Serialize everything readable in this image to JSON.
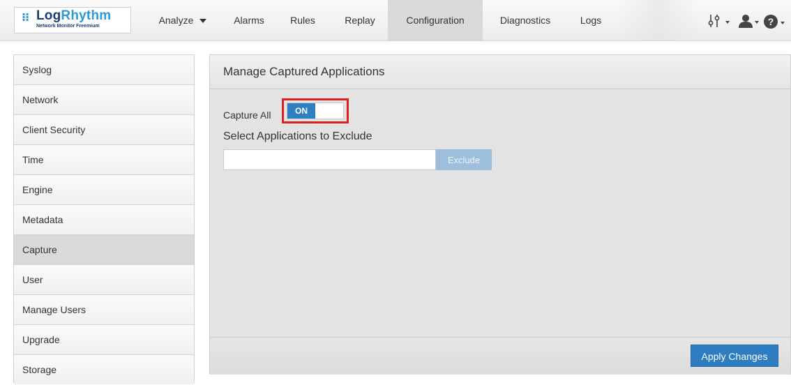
{
  "logo": {
    "name_part1": "Log",
    "name_part2": "Rhythm",
    "subtitle": "Network Monitor Freemium",
    "mark_icon": "dots-grid-icon",
    "colors": {
      "dark": "#1c3d73",
      "accent": "#2b9ad6"
    }
  },
  "nav": {
    "items": [
      {
        "label": "Analyze",
        "has_dropdown": true
      },
      {
        "label": "Alarms"
      },
      {
        "label": "Rules"
      },
      {
        "label": "Replay"
      },
      {
        "label": "Configuration",
        "active": true
      },
      {
        "label": "Diagnostics"
      },
      {
        "label": "Logs"
      }
    ],
    "tools": [
      "sliders-icon",
      "user-icon",
      "help-icon"
    ]
  },
  "sidebar": {
    "active": "Capture",
    "items": [
      {
        "label": "Syslog"
      },
      {
        "label": "Network"
      },
      {
        "label": "Client Security"
      },
      {
        "label": "Time"
      },
      {
        "label": "Engine"
      },
      {
        "label": "Metadata"
      },
      {
        "label": "Capture"
      },
      {
        "label": "User"
      },
      {
        "label": "Manage Users"
      },
      {
        "label": "Upgrade"
      },
      {
        "label": "Storage"
      }
    ]
  },
  "panel": {
    "title": "Manage Captured Applications",
    "capture_all_label": "Capture All",
    "toggle": {
      "label": "ON",
      "state": "on"
    },
    "exclude_heading": "Select Applications to Exclude",
    "exclude_input": {
      "value": "",
      "placeholder": ""
    },
    "exclude_button": "Exclude",
    "apply_button": "Apply Changes"
  },
  "colors": {
    "primary_button": "#2e7dc0",
    "highlight": "#e02020",
    "disabled_button": "#9dbfdb"
  }
}
